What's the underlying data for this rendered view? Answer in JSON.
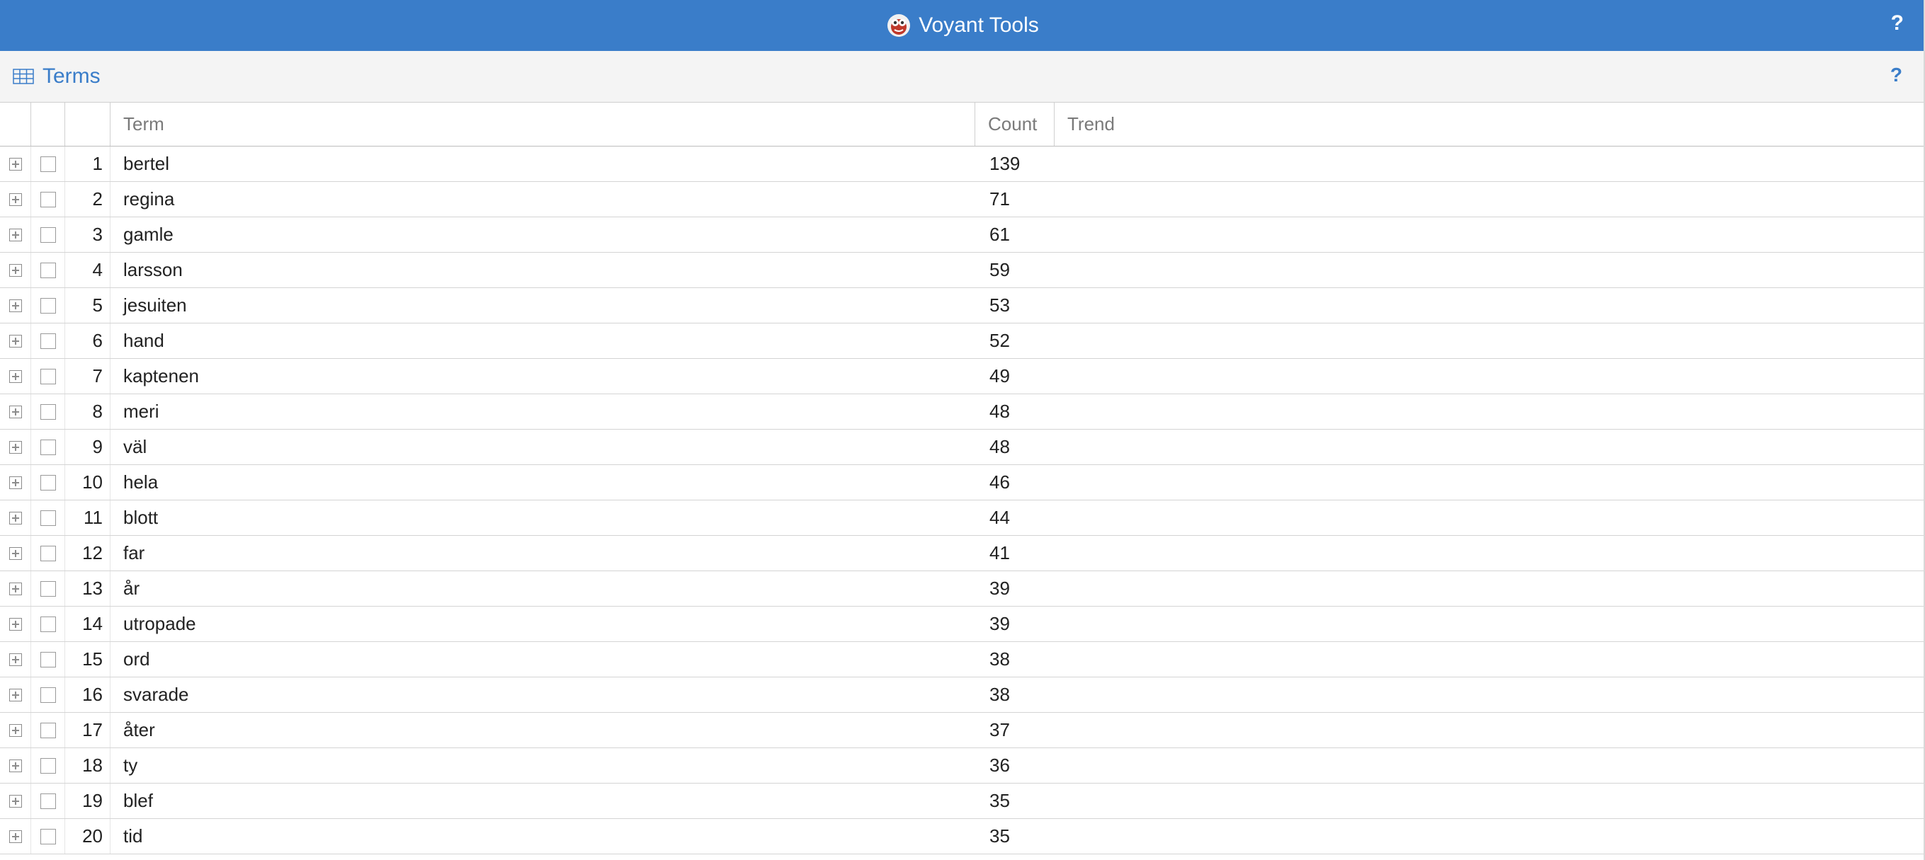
{
  "app": {
    "title": "Voyant Tools",
    "help_label": "?",
    "brand_color": "#3a7dc9"
  },
  "panel": {
    "title": "Terms",
    "icon": "grid-table-icon",
    "help_label": "?"
  },
  "table": {
    "columns": {
      "term": "Term",
      "count": "Count",
      "trend": "Trend"
    },
    "rows": [
      {
        "index": "1",
        "term": "bertel",
        "count": "139"
      },
      {
        "index": "2",
        "term": "regina",
        "count": "71"
      },
      {
        "index": "3",
        "term": "gamle",
        "count": "61"
      },
      {
        "index": "4",
        "term": "larsson",
        "count": "59"
      },
      {
        "index": "5",
        "term": "jesuiten",
        "count": "53"
      },
      {
        "index": "6",
        "term": "hand",
        "count": "52"
      },
      {
        "index": "7",
        "term": "kaptenen",
        "count": "49"
      },
      {
        "index": "8",
        "term": "meri",
        "count": "48"
      },
      {
        "index": "9",
        "term": "väl",
        "count": "48"
      },
      {
        "index": "10",
        "term": "hela",
        "count": "46"
      },
      {
        "index": "11",
        "term": "blott",
        "count": "44"
      },
      {
        "index": "12",
        "term": "far",
        "count": "41"
      },
      {
        "index": "13",
        "term": "år",
        "count": "39"
      },
      {
        "index": "14",
        "term": "utropade",
        "count": "39"
      },
      {
        "index": "15",
        "term": "ord",
        "count": "38"
      },
      {
        "index": "16",
        "term": "svarade",
        "count": "38"
      },
      {
        "index": "17",
        "term": "åter",
        "count": "37"
      },
      {
        "index": "18",
        "term": "ty",
        "count": "36"
      },
      {
        "index": "19",
        "term": "blef",
        "count": "35"
      },
      {
        "index": "20",
        "term": "tid",
        "count": "35"
      }
    ]
  }
}
